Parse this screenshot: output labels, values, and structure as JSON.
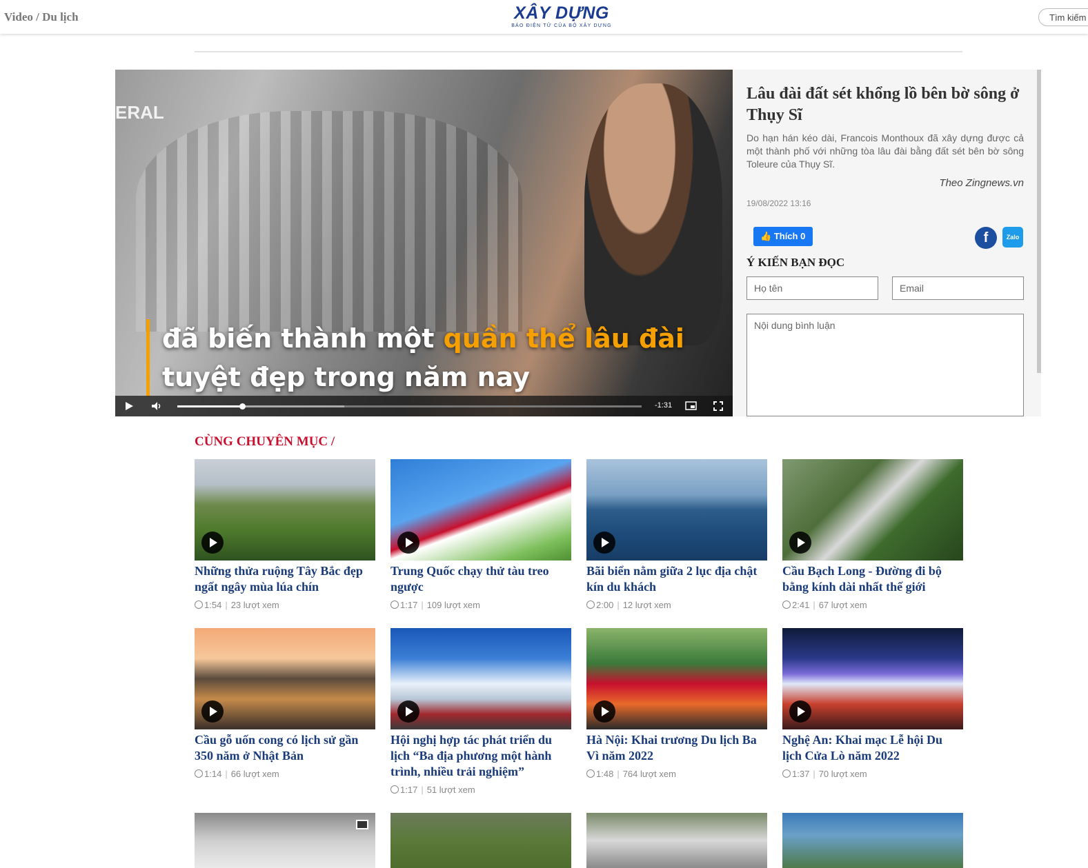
{
  "header": {
    "breadcrumb": "Video / Du lịch",
    "logo_main": "XÂY DỰNG",
    "logo_sub": "BÁO ĐIỆN TỬ CỦA BỘ XÂY DỰNG",
    "search_label": "Tìm kiếm"
  },
  "video": {
    "subtitle_line1_a": "đã biến thành một ",
    "subtitle_line1_b": "quần thể lâu đài",
    "subtitle_line2": "tuyệt đẹp trong năm nay",
    "overlay_text": "ERAL",
    "time_remaining": "-1:31",
    "progress": 0.14,
    "buffered": 0.36
  },
  "article": {
    "title": "Lâu đài đất sét khổng lồ bên bờ sông ở Thụy Sĩ",
    "description": "Do hạn hán kéo dài, Francois Monthoux đã xây dựng được cả một thành phố với những tòa lâu đài bằng đất sét bên bờ sông Toleure của Thụy Sĩ.",
    "source": "Theo Zingnews.vn",
    "date": "19/08/2022 13:16",
    "like_label": "Thích 0"
  },
  "comments": {
    "title": "Ý KIẾN BẠN ĐỌC",
    "name_placeholder": "Họ tên",
    "email_placeholder": "Email",
    "body_placeholder": "Nội dung bình luận"
  },
  "related": {
    "title": "CÙNG CHUYÊN MỤC /",
    "items": [
      {
        "title": "Những thửa ruộng Tây Bắc đẹp ngất ngây mùa lúa chín",
        "duration": "1:54",
        "views": "23 lượt xem"
      },
      {
        "title": "Trung Quốc chạy thử tàu treo ngược",
        "duration": "1:17",
        "views": "109 lượt xem"
      },
      {
        "title": "Bãi biển nằm giữa 2 lục địa chật kín du khách",
        "duration": "2:00",
        "views": "12 lượt xem"
      },
      {
        "title": "Cầu Bạch Long - Đường đi bộ bằng kính dài nhất thế giới",
        "duration": "2:41",
        "views": "67 lượt xem"
      },
      {
        "title": "Cầu gỗ uốn cong có lịch sử gần 350 năm ở Nhật Bản",
        "duration": "1:14",
        "views": "66 lượt xem"
      },
      {
        "title": "Hội nghị hợp tác phát triển du lịch “Ba địa phương một hành trình, nhiều trải nghiệm”",
        "duration": "1:17",
        "views": "51 lượt xem"
      },
      {
        "title": "Hà Nội: Khai trương Du lịch Ba Vì năm 2022",
        "duration": "1:48",
        "views": "764 lượt xem"
      },
      {
        "title": "Nghệ An: Khai mạc Lễ hội Du lịch Cửa Lò năm 2022",
        "duration": "1:37",
        "views": "70 lượt xem"
      }
    ]
  },
  "colors": {
    "brand": "#1a3b8f",
    "section_red": "#c8102e",
    "card_title": "#1a3b7a",
    "subtitle_highlight": "#f5a000"
  }
}
